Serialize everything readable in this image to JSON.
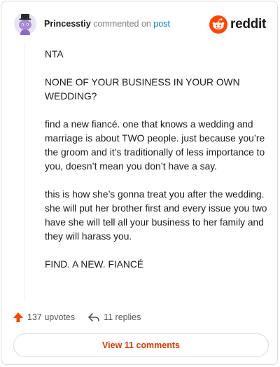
{
  "comment": {
    "username": "Princesstiy",
    "action": "commented on",
    "post_link": "post",
    "brand": "reddit",
    "paragraphs": [
      "NTA",
      "NONE OF YOUR BUSINESS IN YOUR OWN WEDDING?",
      "find a new fiancé. one that knows a wedding and marriage is about TWO people. just because you’re the groom and it’s traditionally of less importance to you, doesn’t mean you don’t have a say.",
      "this is how she’s gonna treat you after the wedding. she will put her brother first and every issue you two have she will tell all your business to her family and they will harass you.",
      "FIND. A NEW. FIANCÉ"
    ]
  },
  "footer": {
    "upvotes": "137 upvotes",
    "replies": "11 replies",
    "view_comments": "View 11 comments"
  },
  "colors": {
    "accent": "#ff4500",
    "link": "#0079d3",
    "button_text": "#d93a00"
  },
  "icons": [
    "avatar-snoo",
    "reddit-logo-icon",
    "upvote-arrow-icon",
    "reply-arrow-icon"
  ]
}
